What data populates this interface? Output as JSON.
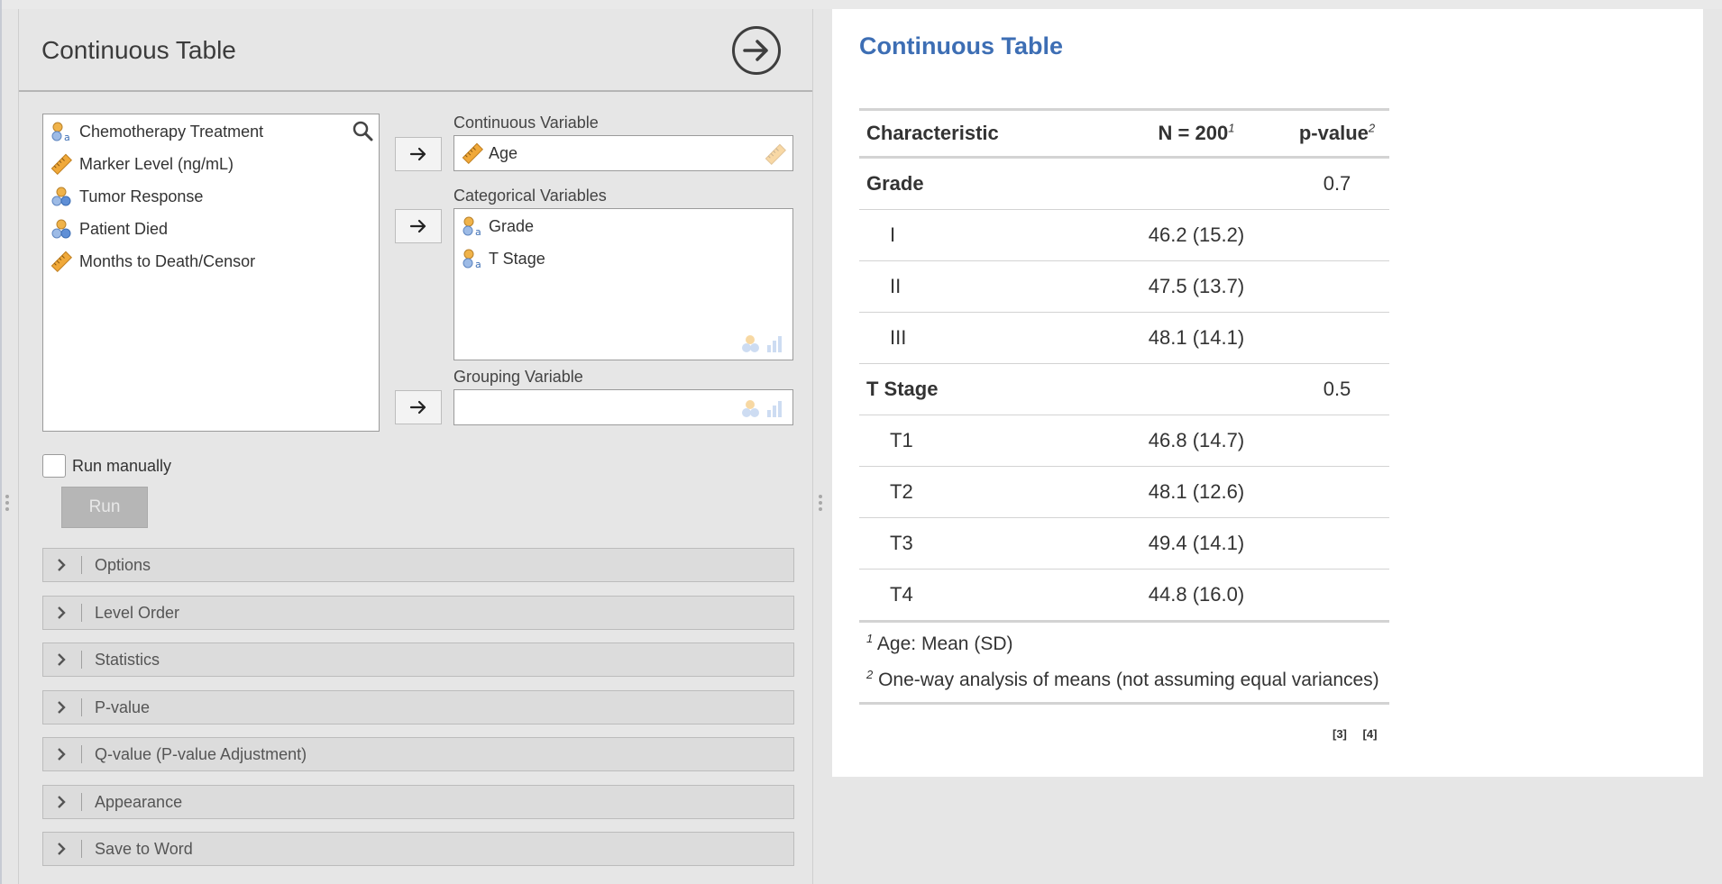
{
  "options": {
    "title": "Continuous Table",
    "available_variables": [
      {
        "name": "Chemotherapy Treatment",
        "icon": "nominal-icon"
      },
      {
        "name": "Marker Level (ng/mL)",
        "icon": "continuous-icon"
      },
      {
        "name": "Tumor Response",
        "icon": "nominal-icon"
      },
      {
        "name": "Patient Died",
        "icon": "nominal-icon"
      },
      {
        "name": "Months to Death/Censor",
        "icon": "continuous-icon"
      }
    ],
    "continuous_variable": {
      "label": "Continuous Variable",
      "value": "Age"
    },
    "categorical_variables": {
      "label": "Categorical Variables",
      "items": [
        "Grade",
        "T Stage"
      ]
    },
    "grouping_variable": {
      "label": "Grouping Variable",
      "value": ""
    },
    "run_manually_label": "Run manually",
    "run_button_label": "Run",
    "sections": [
      "Options",
      "Level Order",
      "Statistics",
      "P-value",
      "Q-value (P-value Adjustment)",
      "Appearance",
      "Save to Word"
    ]
  },
  "results": {
    "title": "Continuous Table",
    "headers": {
      "characteristic": "Characteristic",
      "n": "N = 200",
      "n_note": "1",
      "p": "p-value",
      "p_note": "2"
    },
    "rows": [
      {
        "label": "Grade",
        "value": "",
        "p": "0.7",
        "group": true
      },
      {
        "label": "I",
        "value": "46.2 (15.2)",
        "p": "",
        "group": false
      },
      {
        "label": "II",
        "value": "47.5 (13.7)",
        "p": "",
        "group": false
      },
      {
        "label": "III",
        "value": "48.1 (14.1)",
        "p": "",
        "group": false
      },
      {
        "label": "T Stage",
        "value": "",
        "p": "0.5",
        "group": true
      },
      {
        "label": "T1",
        "value": "46.8 (14.7)",
        "p": "",
        "group": false
      },
      {
        "label": "T2",
        "value": "48.1 (12.6)",
        "p": "",
        "group": false
      },
      {
        "label": "T3",
        "value": "49.4 (14.1)",
        "p": "",
        "group": false
      },
      {
        "label": "T4",
        "value": "44.8 (16.0)",
        "p": "",
        "group": false
      }
    ],
    "footnotes": [
      {
        "mark": "1",
        "text": "Age: Mean (SD)"
      },
      {
        "mark": "2",
        "text": "One-way analysis of means (not assuming equal variances)"
      }
    ],
    "refs": [
      "[3]",
      "[4]"
    ]
  },
  "colors": {
    "accent": "#3d6eb4",
    "nominal_icon": "#f0b34a",
    "continuous_icon": "#f0a93a"
  }
}
